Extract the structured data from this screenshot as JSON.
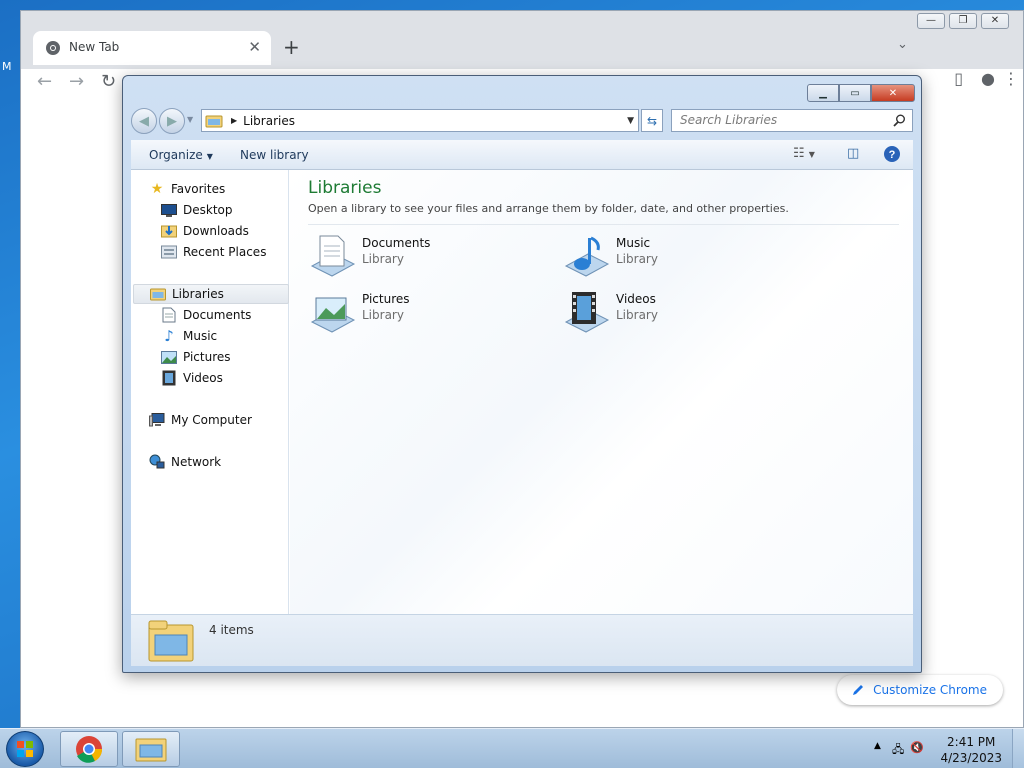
{
  "desktop": {
    "edge_letter": "M"
  },
  "chrome": {
    "tab_title": "New Tab",
    "tab_close": "✕",
    "newtab": "+",
    "customize_label": "Customize Chrome"
  },
  "explorer": {
    "address_crumb": "Libraries",
    "search_placeholder": "Search Libraries",
    "commands": {
      "organize": "Organize",
      "new_library": "New library"
    },
    "nav": {
      "favorites": "Favorites",
      "desktop": "Desktop",
      "downloads": "Downloads",
      "recent_places": "Recent Places",
      "libraries": "Libraries",
      "documents": "Documents",
      "music": "Music",
      "pictures": "Pictures",
      "videos": "Videos",
      "my_computer": "My Computer",
      "network": "Network"
    },
    "main": {
      "title": "Libraries",
      "subtitle": "Open a library to see your files and arrange them by folder, date, and other properties.",
      "items": [
        {
          "name": "Documents",
          "kind": "Library"
        },
        {
          "name": "Music",
          "kind": "Library"
        },
        {
          "name": "Pictures",
          "kind": "Library"
        },
        {
          "name": "Videos",
          "kind": "Library"
        }
      ]
    },
    "details_count": "4 items"
  },
  "taskbar": {
    "time": "2:41 PM",
    "date": "4/23/2023"
  },
  "colors": {
    "title_green": "#1e7b34",
    "accent_blue": "#1a73e8",
    "close_red": "#c63c22"
  }
}
